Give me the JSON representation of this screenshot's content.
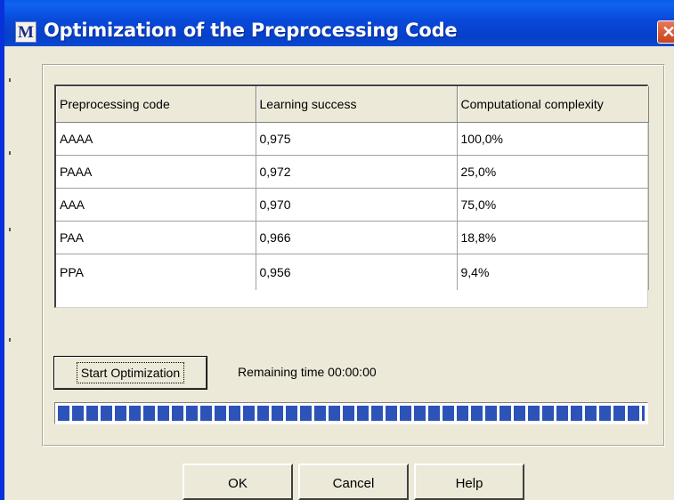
{
  "window": {
    "title": "Optimization of the Preprocessing Code",
    "app_icon_glyph": "M",
    "close_glyph": "✕"
  },
  "table": {
    "columns": [
      "Preprocessing code",
      "Learning success",
      "Computational complexity"
    ],
    "rows": [
      [
        "AAAA",
        "0,975",
        "100,0%"
      ],
      [
        "PAAA",
        "0,972",
        "25,0%"
      ],
      [
        "AAA",
        "0,970",
        "75,0%"
      ],
      [
        "PAA",
        "0,966",
        "18,8%"
      ],
      [
        "PPA",
        "0,956",
        "9,4%"
      ]
    ]
  },
  "optimization": {
    "start_label": "Start Optimization",
    "remaining_time": "Remaining time 00:00:00",
    "progress_fraction": 1.0
  },
  "footer": {
    "ok_label": "OK",
    "cancel_label": "Cancel",
    "help_label": "Help"
  },
  "colors": {
    "titlebar": "#0848d8",
    "progress": "#2d52b8",
    "face": "#ece9d8"
  }
}
